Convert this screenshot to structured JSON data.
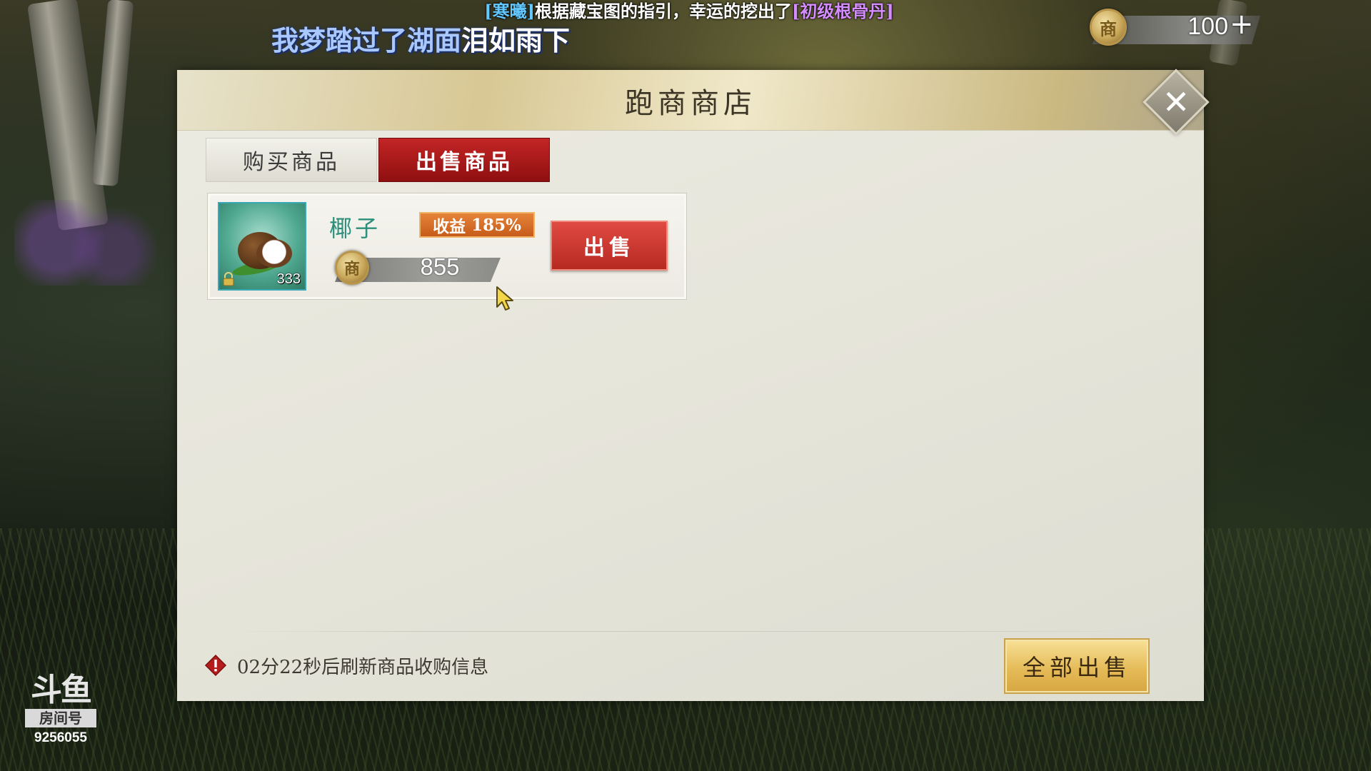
{
  "system_message": {
    "player": "[寒曦]",
    "text": "根据藏宝图的指引，幸运的挖出了",
    "item": "[初级根骨丹]"
  },
  "danmaku": {
    "part1": "我梦踏过了",
    "highlight": "湖面",
    "part2": "泪如雨下"
  },
  "currency": {
    "coin_symbol": "商",
    "amount": "100",
    "add_label": "+"
  },
  "dialog": {
    "title": "跑商商店",
    "close_icon": "close-icon",
    "tabs": {
      "buy": "购买商品",
      "sell": "出售商品",
      "active": "sell"
    },
    "items": [
      {
        "name": "椰子",
        "count": "333",
        "icon": "coconut-icon",
        "locked": true,
        "profit_label": "收益",
        "profit_value": "185%",
        "price_symbol": "商",
        "price": "855",
        "sell_label": "出售"
      }
    ],
    "refresh_info": "02分22秒后刷新商品收购信息",
    "sell_all_label": "全部出售"
  },
  "watermark": {
    "logo": "斗鱼",
    "label": "房间号",
    "room_id": "9256055"
  },
  "colors": {
    "active_tab": "#b31a1a",
    "sell_button": "#d23c34",
    "profit_badge": "#d86e28",
    "sell_all_button": "#e9c463",
    "item_name": "#2c8f7b"
  }
}
